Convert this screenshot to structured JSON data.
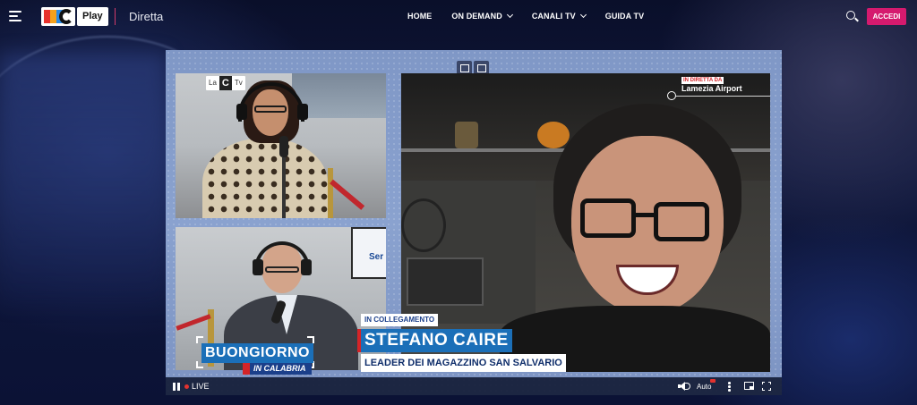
{
  "header": {
    "logo_text": "Play",
    "section_title": "Diretta",
    "nav": [
      {
        "label": "HOME",
        "has_dropdown": false
      },
      {
        "label": "ON DEMAND",
        "has_dropdown": true
      },
      {
        "label": "CANALI TV",
        "has_dropdown": true
      },
      {
        "label": "GUIDA TV",
        "has_dropdown": false
      }
    ],
    "login_label": "ACCEDI",
    "icons": [
      "menu-icon",
      "search-icon"
    ],
    "accent_color": "#d51a6e"
  },
  "player": {
    "channel_badge": {
      "left": "La",
      "center": "C",
      "right": "Tv"
    },
    "studio_monitor_text": "Ser",
    "show_title": "BUONGIORNO",
    "show_subtitle": "IN CALABRIA",
    "live_location_tag": "IN DIRETTA DA",
    "live_location": "Lamezia Airport",
    "lower_third": {
      "tag": "IN COLLEGAMENTO",
      "name": "STEFANO CAIRE",
      "role": "LEADER DEI MAGAZZINO SAN SALVARIO"
    },
    "controls": {
      "live_label": "LIVE",
      "quality_label": "Auto",
      "icons": [
        "pause-icon",
        "volume-icon",
        "more-vertical-icon",
        "picture-in-picture-icon",
        "fullscreen-icon"
      ]
    },
    "brand_blue": "#1b6fb8",
    "brand_red": "#d42428"
  }
}
